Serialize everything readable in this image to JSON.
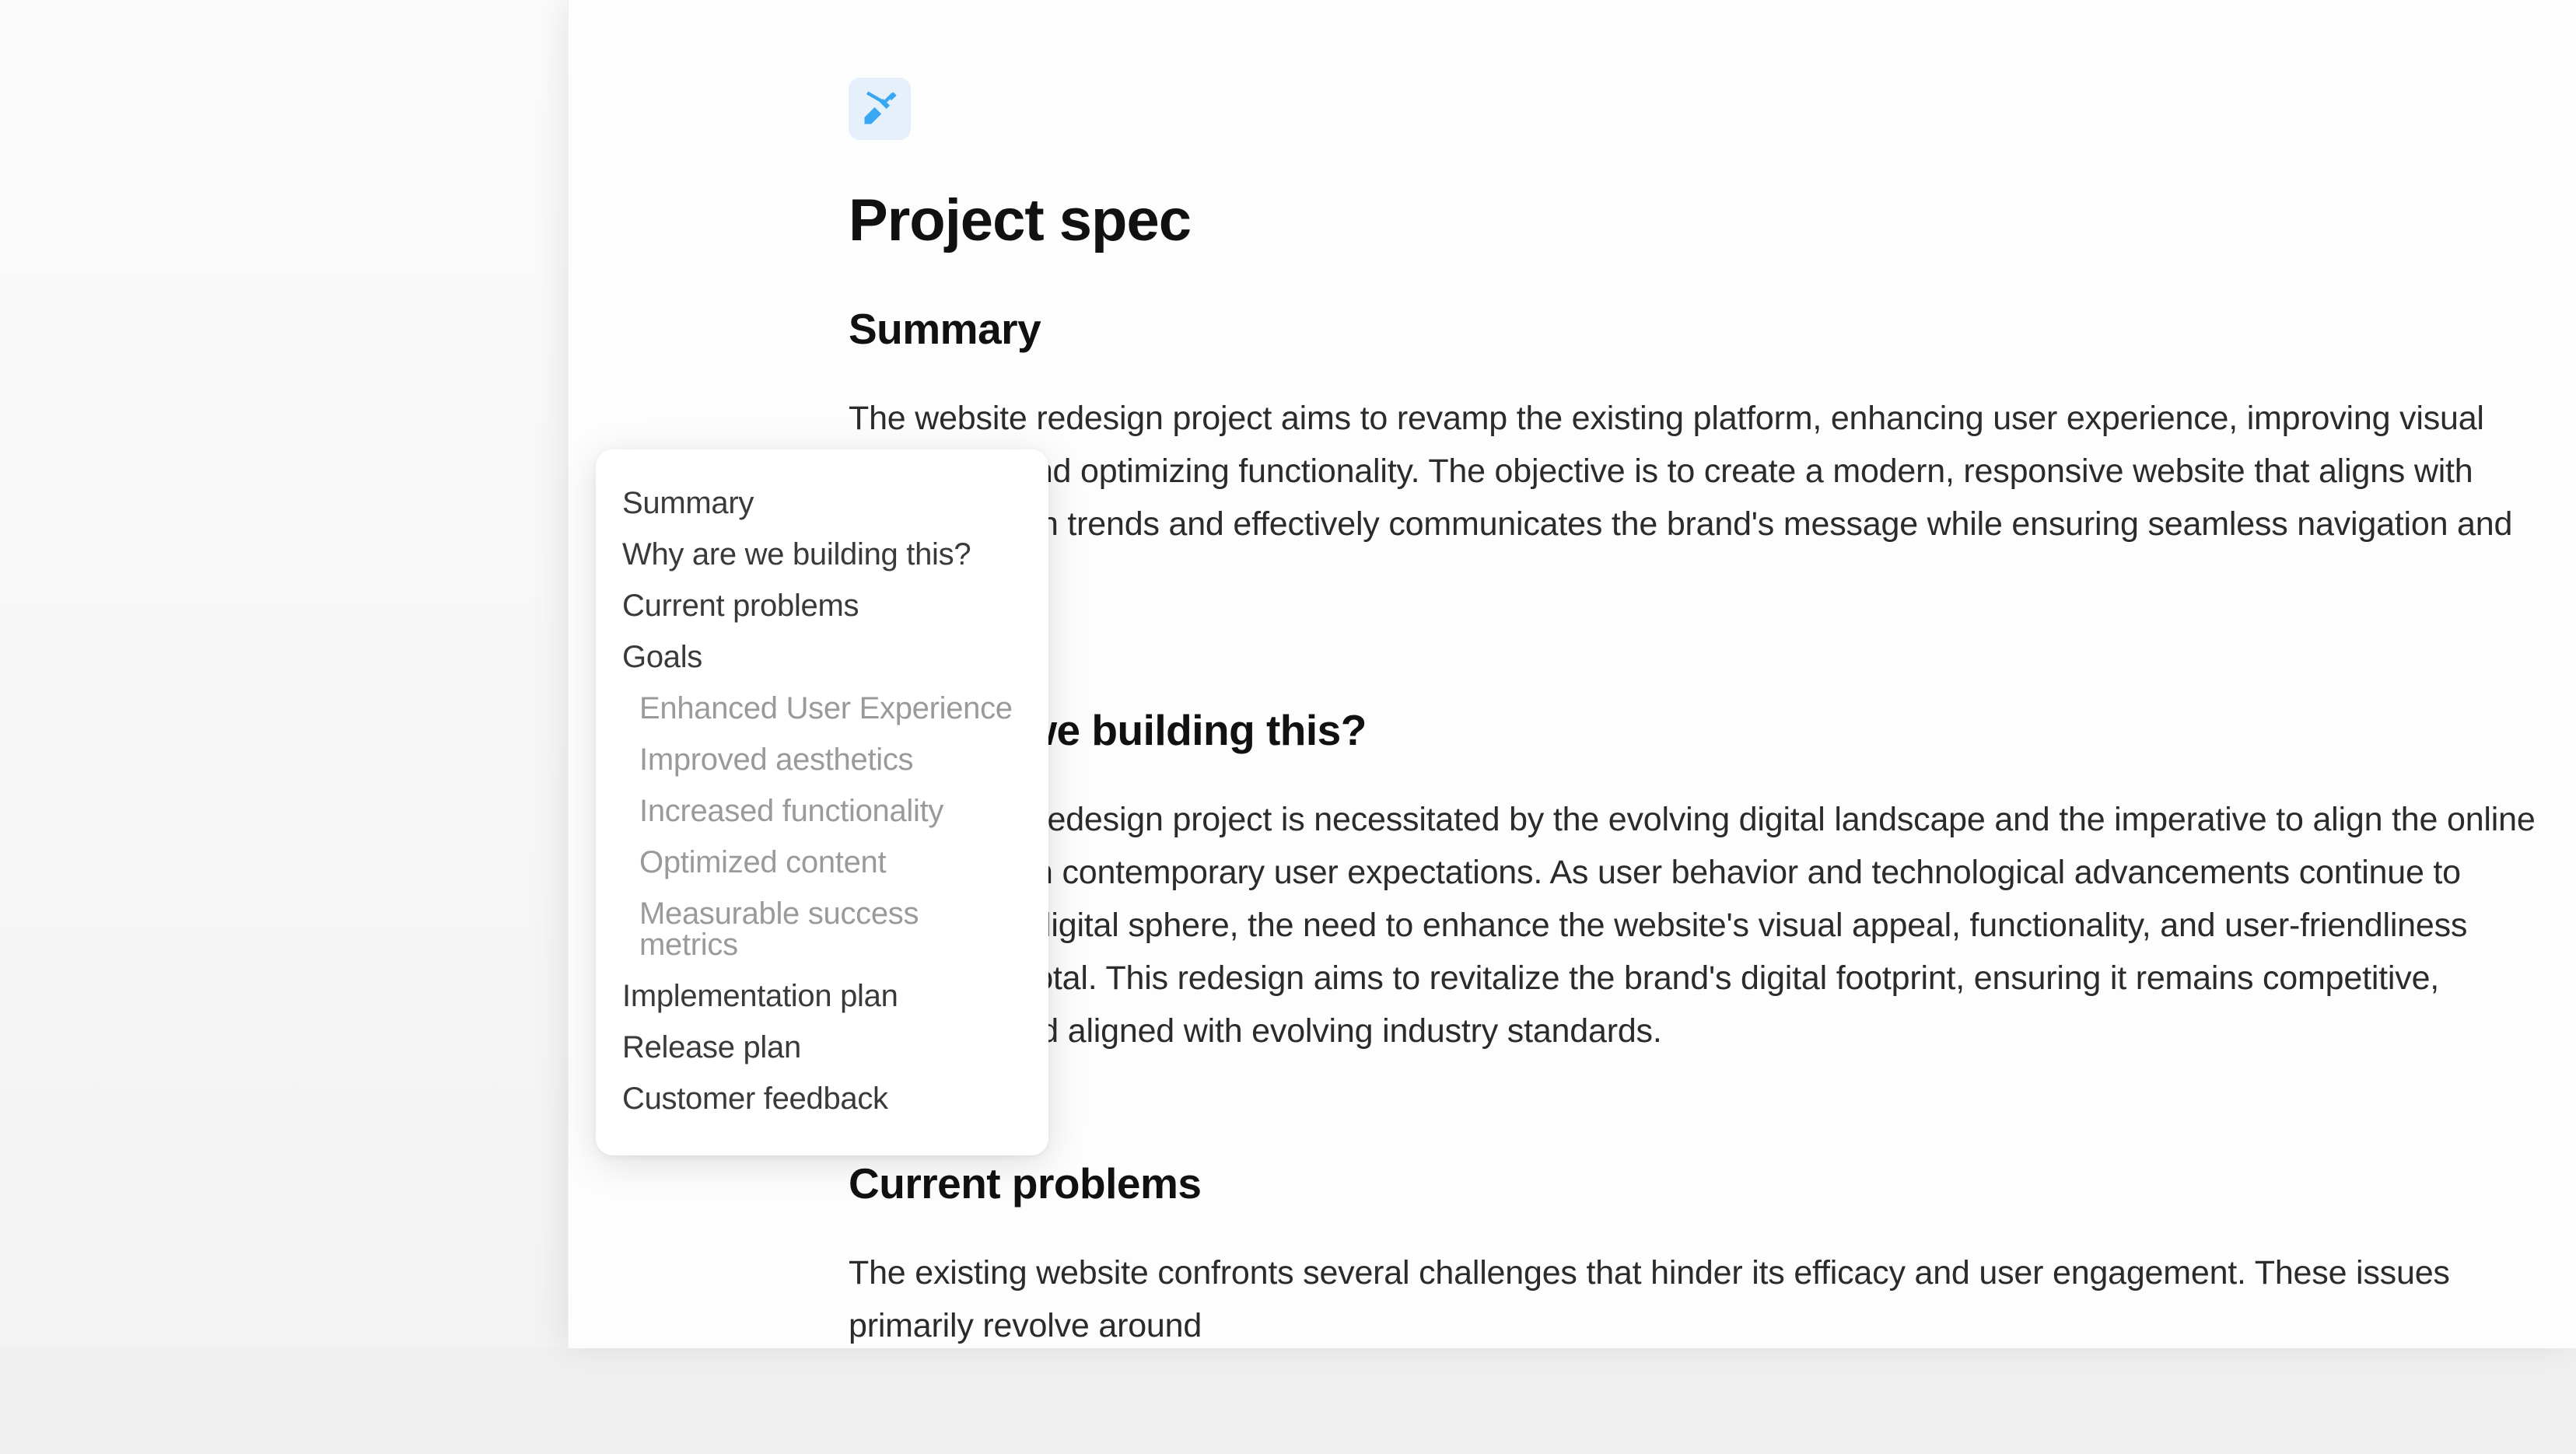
{
  "doc": {
    "title": "Project spec",
    "icon": "design-tools-icon",
    "sections": {
      "summary": {
        "heading": "Summary",
        "body": "The website redesign project aims to revamp the existing platform, enhancing user experience, improving visual aesthetics, and optimizing functionality. The objective is to create a modern, responsive website that aligns with current design trends and effectively communicates the brand's message while ensuring seamless navigation and accessibility."
      },
      "why": {
        "heading": "Why are we building this?",
        "body": "The website redesign project is necessitated by the evolving digital landscape and the imperative to align the online presence with contemporary user expectations. As user behavior and technological advancements continue to reshape the digital sphere, the need to enhance the website's visual appeal, functionality, and user-friendliness becomes pivotal. This redesign aims to revitalize the brand's digital footprint, ensuring it remains competitive, engaging, and aligned with evolving industry standards."
      },
      "problems": {
        "heading": "Current problems",
        "body": "The existing website confronts several challenges that hinder its efficacy and user engagement. These issues primarily revolve around"
      }
    }
  },
  "toc": {
    "items": [
      {
        "label": "Summary",
        "level": 0
      },
      {
        "label": "Why are we building this?",
        "level": 0
      },
      {
        "label": "Current problems",
        "level": 0
      },
      {
        "label": "Goals",
        "level": 0
      },
      {
        "label": "Enhanced User Experience",
        "level": 1
      },
      {
        "label": "Improved aesthetics",
        "level": 1
      },
      {
        "label": "Increased functionality",
        "level": 1
      },
      {
        "label": "Optimized content",
        "level": 1
      },
      {
        "label": "Measurable success metrics",
        "level": 1
      },
      {
        "label": "Implementation plan",
        "level": 0
      },
      {
        "label": "Release plan",
        "level": 0
      },
      {
        "label": "Customer feedback",
        "level": 0
      }
    ]
  }
}
